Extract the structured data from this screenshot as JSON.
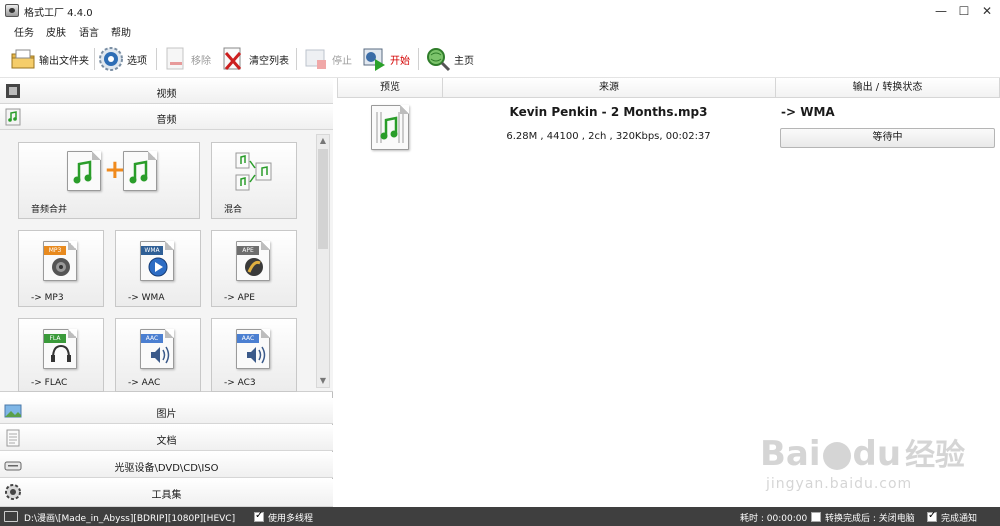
{
  "window": {
    "title": "格式工厂 4.4.0",
    "controls": [
      "—",
      "☐",
      "✕"
    ]
  },
  "menu": [
    "任务",
    "皮肤",
    "语言",
    "帮助"
  ],
  "toolbar": {
    "output_folder": "输出文件夹",
    "options": "选项",
    "remove": "移除",
    "clear_list": "清空列表",
    "stop": "停止",
    "start": "开始",
    "home": "主页"
  },
  "sidebar": {
    "categories_top": [
      "视频",
      "音频"
    ],
    "tiles": [
      {
        "label": "音频合并"
      },
      {
        "label": "混合"
      },
      {
        "label": "-> MP3",
        "tag": "MP3"
      },
      {
        "label": "-> WMA",
        "tag": "WMA"
      },
      {
        "label": "-> APE",
        "tag": "APE"
      },
      {
        "label": "-> FLAC",
        "tag": "FLA"
      },
      {
        "label": "-> AAC",
        "tag": "AAC"
      },
      {
        "label": "-> AC3",
        "tag": "AAC"
      }
    ],
    "categories_bottom": [
      "图片",
      "文档",
      "光驱设备\\DVD\\CD\\ISO",
      "工具集"
    ]
  },
  "task_list": {
    "columns": [
      "预览",
      "来源",
      "输出 / 转换状态"
    ],
    "rows": [
      {
        "filename": "Kevin Penkin - 2 Months.mp3",
        "info": "6.28M , 44100 , 2ch , 320Kbps, 00:02:37",
        "output": "-> WMA",
        "status": "等待中"
      }
    ]
  },
  "statusbar": {
    "output_path": "D:\\漫画\\[Made_in_Abyss][BDRIP][1080P][HEVC]",
    "multithread": "使用多线程",
    "elapsed": "耗时 : 00:00:00",
    "after_convert": "转换完成后 : 关闭电脑",
    "notify": "完成通知"
  },
  "watermark": {
    "brand": "Bai",
    "brand2": "du",
    "cn": "经验",
    "url": "jingyan.baidu.com"
  },
  "colors": {
    "accent_green": "#2a9d2a",
    "start_red": "#d40000",
    "statusbar_bg": "#3f3f3f"
  }
}
